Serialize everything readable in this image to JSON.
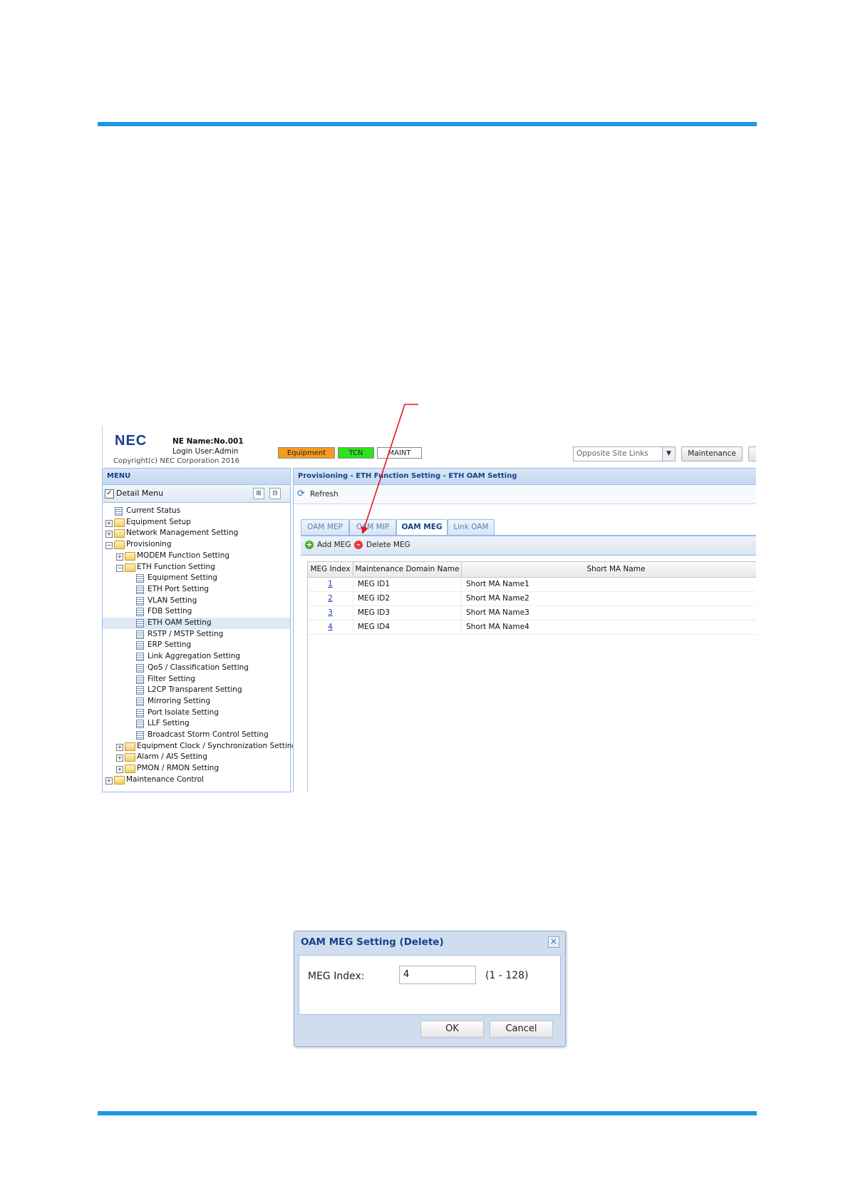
{
  "app": {
    "logo": "NEC",
    "ne_name": "NE Name:No.001",
    "login_user": "Login User:Admin",
    "copyright": "Copyright(c) NEC Corporation 2016",
    "status": {
      "equipment": "Equipment",
      "tcn": "TCN",
      "maint": "MAINT"
    },
    "status_colors": {
      "equipment": "#f59c1f",
      "tcn": "#2ee21c",
      "maint": "#ffffff"
    },
    "opposite_site_links": "Opposite Site Links",
    "maintenance_button": "Maintenance"
  },
  "menu": {
    "header": "MENU",
    "detail_menu": "Detail Menu",
    "detail_menu_checked": true,
    "tree": [
      {
        "label": "Current Status",
        "type": "page"
      },
      {
        "label": "Equipment Setup",
        "type": "folder",
        "expanded": false
      },
      {
        "label": "Network Management Setting",
        "type": "folder",
        "expanded": false
      },
      {
        "label": "Provisioning",
        "type": "folder",
        "expanded": true
      },
      {
        "label": "MODEM Function Setting",
        "type": "folder",
        "expanded": false
      },
      {
        "label": "ETH Function Setting",
        "type": "folder",
        "expanded": true
      },
      {
        "label": "Equipment Setting",
        "type": "page"
      },
      {
        "label": "ETH Port Setting",
        "type": "page"
      },
      {
        "label": "VLAN Setting",
        "type": "page"
      },
      {
        "label": "FDB Setting",
        "type": "page"
      },
      {
        "label": "ETH OAM Setting",
        "type": "page",
        "selected": true
      },
      {
        "label": "RSTP / MSTP Setting",
        "type": "page"
      },
      {
        "label": "ERP Setting",
        "type": "page"
      },
      {
        "label": "Link Aggregation Setting",
        "type": "page"
      },
      {
        "label": "QoS / Classification Setting",
        "type": "page"
      },
      {
        "label": "Filter Setting",
        "type": "page"
      },
      {
        "label": "L2CP Transparent Setting",
        "type": "page"
      },
      {
        "label": "Mirroring Setting",
        "type": "page"
      },
      {
        "label": "Port Isolate Setting",
        "type": "page"
      },
      {
        "label": "LLF Setting",
        "type": "page"
      },
      {
        "label": "Broadcast Storm Control Setting",
        "type": "page"
      },
      {
        "label": "Equipment Clock / Synchronization Setting",
        "type": "folder",
        "expanded": false
      },
      {
        "label": "Alarm / AIS Setting",
        "type": "folder",
        "expanded": false
      },
      {
        "label": "PMON / RMON Setting",
        "type": "folder",
        "expanded": false
      },
      {
        "label": "Maintenance Control",
        "type": "folder",
        "expanded": false
      }
    ]
  },
  "main": {
    "breadcrumb": "Provisioning - ETH Function Setting - ETH OAM Setting",
    "refresh": "Refresh",
    "tabs": [
      "OAM MEP",
      "OAM MIP",
      "OAM MEG",
      "Link OAM"
    ],
    "active_tab": "OAM MEG",
    "add_meg": "Add MEG",
    "delete_meg": "Delete MEG",
    "columns": [
      "MEG Index",
      "Maintenance Domain Name",
      "Short MA Name"
    ],
    "rows": [
      {
        "index": "1",
        "domain": "MEG ID1",
        "short_ma": "Short MA Name1"
      },
      {
        "index": "2",
        "domain": "MEG ID2",
        "short_ma": "Short MA Name2"
      },
      {
        "index": "3",
        "domain": "MEG ID3",
        "short_ma": "Short MA Name3"
      },
      {
        "index": "4",
        "domain": "MEG ID4",
        "short_ma": "Short MA Name4"
      }
    ]
  },
  "dialog": {
    "title": "OAM MEG Setting (Delete)",
    "meg_index_label": "MEG Index:",
    "meg_index_value": "4",
    "range": "(1 - 128)",
    "ok": "OK",
    "cancel": "Cancel"
  },
  "annotation_color": "#e8161d"
}
